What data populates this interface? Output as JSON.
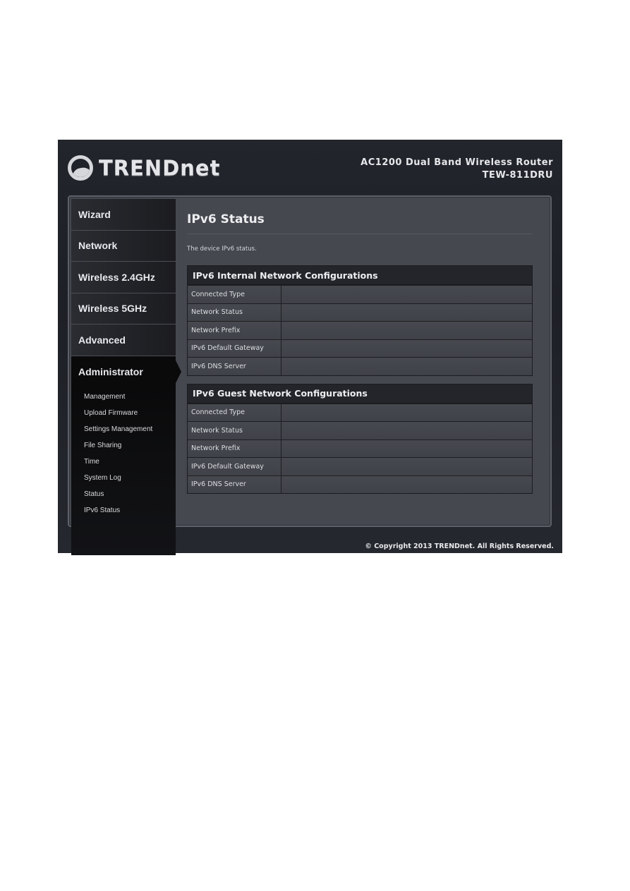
{
  "header": {
    "logo_text": "TRENDnet",
    "product_line": "AC1200 Dual Band Wireless Router",
    "model": "TEW-811DRU"
  },
  "sidebar": {
    "items": [
      {
        "label": "Wizard"
      },
      {
        "label": "Network"
      },
      {
        "label": "Wireless 2.4GHz"
      },
      {
        "label": "Wireless 5GHz"
      },
      {
        "label": "Advanced"
      },
      {
        "label": "Administrator",
        "active": true
      }
    ],
    "subitems": [
      {
        "label": "Management"
      },
      {
        "label": "Upload Firmware"
      },
      {
        "label": "Settings Management"
      },
      {
        "label": "File Sharing"
      },
      {
        "label": "Time"
      },
      {
        "label": "System Log"
      },
      {
        "label": "Status"
      },
      {
        "label": "IPv6 Status",
        "active": true
      }
    ]
  },
  "main": {
    "title": "IPv6 Status",
    "description": "The device IPv6 status.",
    "tables": [
      {
        "title": "IPv6 Internal Network Configurations",
        "rows": [
          {
            "label": "Connected Type",
            "value": ""
          },
          {
            "label": "Network Status",
            "value": ""
          },
          {
            "label": "Network Prefix",
            "value": ""
          },
          {
            "label": "IPv6 Default Gateway",
            "value": ""
          },
          {
            "label": "IPv6 DNS Server",
            "value": ""
          }
        ]
      },
      {
        "title": "IPv6 Guest Network Configurations",
        "rows": [
          {
            "label": "Connected Type",
            "value": ""
          },
          {
            "label": "Network Status",
            "value": ""
          },
          {
            "label": "Network Prefix",
            "value": ""
          },
          {
            "label": "IPv6 Default Gateway",
            "value": ""
          },
          {
            "label": "IPv6 DNS Server",
            "value": ""
          }
        ]
      }
    ]
  },
  "footer": {
    "copyright": "© Copyright 2013 TRENDnet. All Rights Reserved."
  }
}
